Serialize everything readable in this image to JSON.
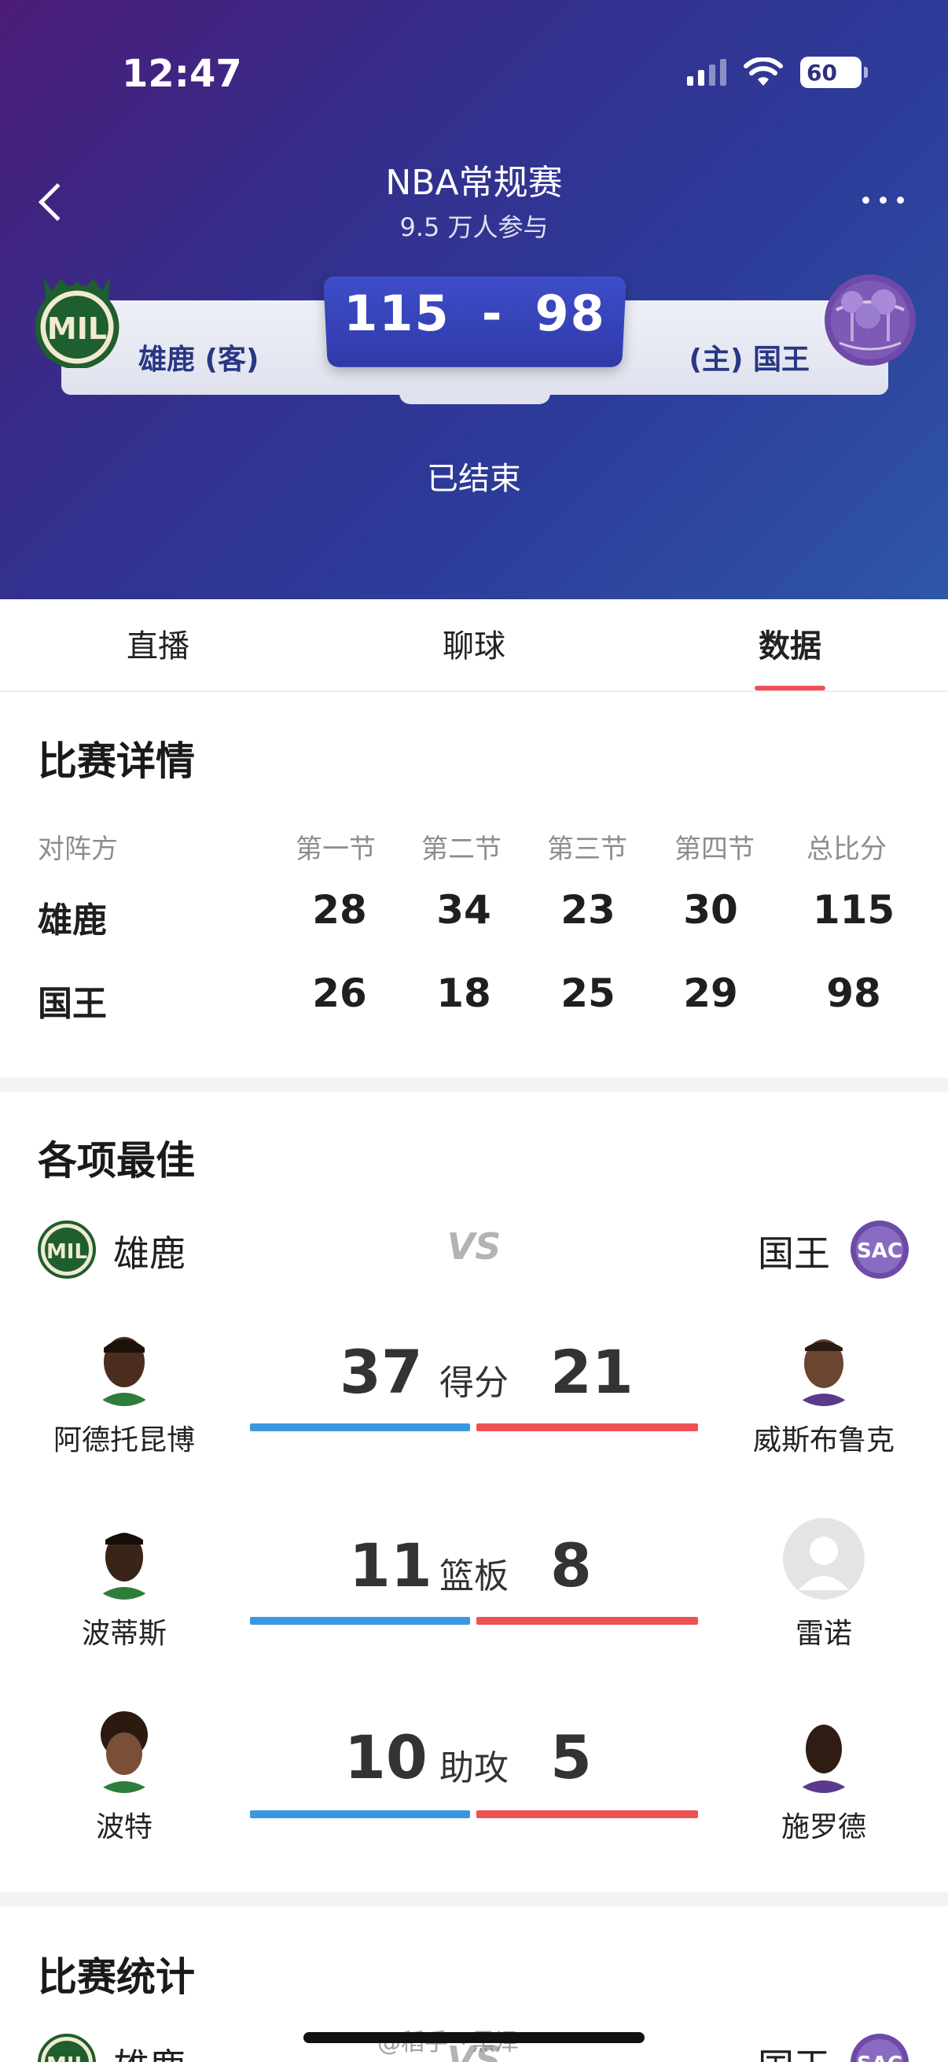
{
  "status_bar": {
    "time": "12:47",
    "battery": "60"
  },
  "header": {
    "title": "NBA常规赛",
    "subtitle": "9.5 万人参与",
    "away_team_label": "雄鹿 (客)",
    "home_team_label": "(主) 国王",
    "away_score": "115",
    "dash": "-",
    "home_score": "98",
    "game_status": "已结束",
    "away_logo_text": "MIL",
    "home_logo_text": "SAC",
    "colors": {
      "bucks_green": "#1f5e2e",
      "kings_purple": "#6e4aa8",
      "score_box": "#3443b8"
    }
  },
  "tabs": [
    {
      "label": "直播"
    },
    {
      "label": "聊球"
    },
    {
      "label": "数据",
      "active": true
    }
  ],
  "game_details": {
    "title": "比赛详情",
    "columns": [
      "对阵方",
      "第一节",
      "第二节",
      "第三节",
      "第四节",
      "总比分"
    ],
    "rows": [
      {
        "team": "雄鹿",
        "q1": "28",
        "q2": "34",
        "q3": "23",
        "q4": "30",
        "total": "115"
      },
      {
        "team": "国王",
        "q1": "26",
        "q2": "18",
        "q3": "25",
        "q4": "29",
        "total": "98"
      }
    ]
  },
  "best_players": {
    "title": "各项最佳",
    "away_team": "雄鹿",
    "home_team": "国王",
    "vs": "VS",
    "categories": [
      {
        "label": "得分",
        "away_value": "37",
        "home_value": "21",
        "away_player": "阿德托昆博",
        "home_player": "威斯布鲁克"
      },
      {
        "label": "篮板",
        "away_value": "11",
        "home_value": "8",
        "away_player": "波蒂斯",
        "home_player": "雷诺"
      },
      {
        "label": "助攻",
        "away_value": "10",
        "home_value": "5",
        "away_player": "波特",
        "home_player": "施罗德"
      }
    ]
  },
  "game_stats": {
    "title": "比赛统计",
    "away_team": "雄鹿",
    "home_team": "国王",
    "vs": "VS"
  },
  "watermark": "@稻手丶黑泽"
}
